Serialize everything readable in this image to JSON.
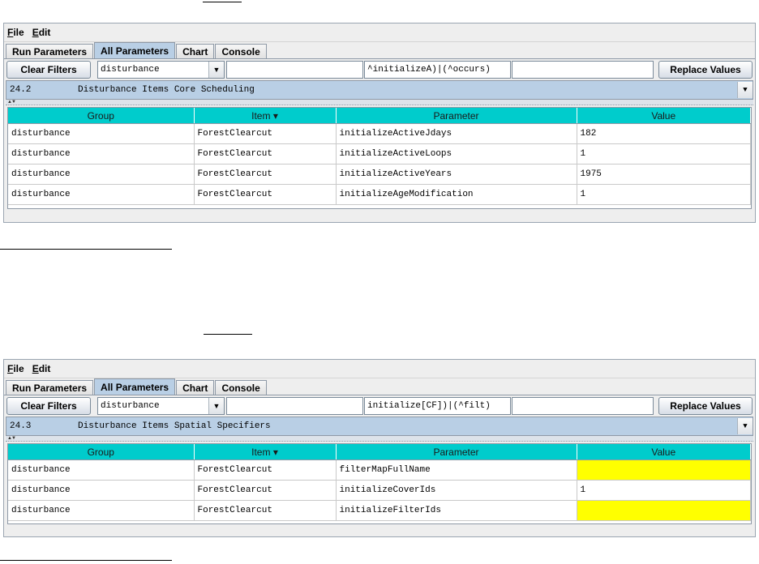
{
  "windows": [
    {
      "menu": [
        {
          "mnemonic": "F",
          "rest": "ile"
        },
        {
          "mnemonic": "E",
          "rest": "dit"
        }
      ],
      "tabs": [
        "Run Parameters",
        "All Parameters",
        "Chart",
        "Console"
      ],
      "active_tab": "All Parameters",
      "toolbar": {
        "clear_label": "Clear Filters",
        "group_combo": "disturbance",
        "filter1": "",
        "filter2": "^initializeA)|(^occurs)",
        "filter3": "",
        "replace_label": "Replace Values"
      },
      "section": {
        "number": "24.2",
        "title": "Disturbance Items Core Scheduling"
      },
      "columns": [
        "Group",
        "Item ▾",
        "Parameter",
        "Value"
      ],
      "rows": [
        {
          "group": "disturbance",
          "item": "ForestClearcut",
          "param": "initializeActiveJdays",
          "value": "182"
        },
        {
          "group": "disturbance",
          "item": "ForestClearcut",
          "param": "initializeActiveLoops",
          "value": "1"
        },
        {
          "group": "disturbance",
          "item": "ForestClearcut",
          "param": "initializeActiveYears",
          "value": "1975"
        },
        {
          "group": "disturbance",
          "item": "ForestClearcut",
          "param": "initializeAgeModification",
          "value": "1"
        }
      ]
    },
    {
      "menu": [
        {
          "mnemonic": "F",
          "rest": "ile"
        },
        {
          "mnemonic": "E",
          "rest": "dit"
        }
      ],
      "tabs": [
        "Run Parameters",
        "All Parameters",
        "Chart",
        "Console"
      ],
      "active_tab": "All Parameters",
      "toolbar": {
        "clear_label": "Clear Filters",
        "group_combo": "disturbance",
        "filter1": "",
        "filter2": "initialize[CF])|(^filt)",
        "filter3": "",
        "replace_label": "Replace Values"
      },
      "section": {
        "number": "24.3",
        "title": "Disturbance Items Spatial Specifiers"
      },
      "columns": [
        "Group",
        "Item ▾",
        "Parameter",
        "Value"
      ],
      "rows": [
        {
          "group": "disturbance",
          "item": "ForestClearcut",
          "param": "filterMapFullName",
          "value": "",
          "highlight": "#ffff00"
        },
        {
          "group": "disturbance",
          "item": "ForestClearcut",
          "param": "initializeCoverIds",
          "value": "1"
        },
        {
          "group": "disturbance",
          "item": "ForestClearcut",
          "param": "initializeFilterIds",
          "value": "",
          "highlight": "#ffff00"
        }
      ]
    }
  ],
  "colors": {
    "header_cyan": "#00cccc",
    "section_blue": "#b9cfe5",
    "empty_value": "#ffff00"
  }
}
